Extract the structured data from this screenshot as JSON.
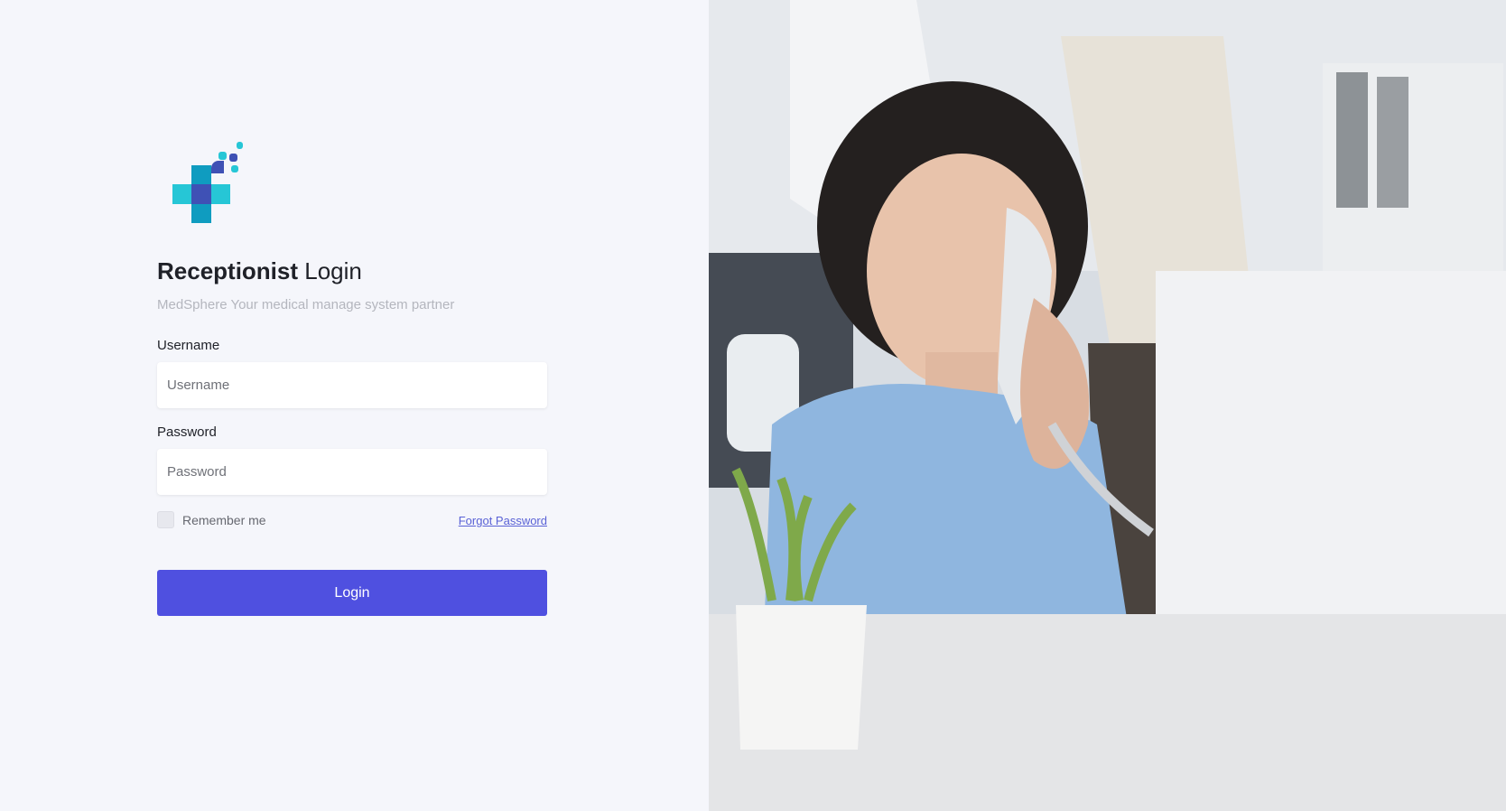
{
  "brand": {
    "name": "MedSphere",
    "logo": "medical-cross-logo"
  },
  "login": {
    "title_bold": "Receptionist",
    "title_rest": " Login",
    "subtitle": "MedSphere Your medical manage system partner",
    "username_label": "Username",
    "username_placeholder": "Username",
    "password_label": "Password",
    "password_placeholder": "Password",
    "remember_label": "Remember me",
    "forgot_label": "Forgot Password",
    "button_label": "Login"
  },
  "colors": {
    "accent": "#4f50e0",
    "background": "#f5f6fb",
    "logo_teal": "#26c6d6",
    "logo_blue": "#3f51b5",
    "logo_deep": "#1c2a8c"
  },
  "hero": {
    "image": "receptionist-on-phone-photo"
  }
}
